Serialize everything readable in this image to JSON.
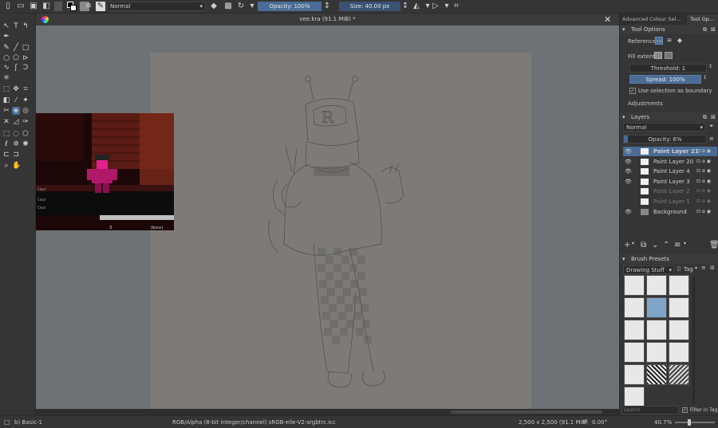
{
  "toolbar": {
    "blend_mode": "Normal",
    "opacity_label": "Opacity: 100%",
    "size_label": "Size: 40.00 px"
  },
  "document": {
    "title": "vee.kra (91.1 MiB) *"
  },
  "dock_tabs": {
    "advanced_colour": "Advanced Colour Sel...",
    "tool_options": "Tool Op..."
  },
  "tool_options": {
    "header": "Tool Options",
    "reference_label": "Reference",
    "fill_extent_label": "Fill extent",
    "threshold_label": "Threshold: 1",
    "spread_label": "Spread: 100%",
    "use_selection_label": "Use selection as boundary",
    "adjustments_label": "Adjustments"
  },
  "layers": {
    "header": "Layers",
    "blend_mode": "Normal",
    "opacity_label": "Opacity:  6%",
    "items": [
      {
        "name": "Paint Layer 21",
        "visible": true,
        "selected": true
      },
      {
        "name": "Paint Layer 20",
        "visible": true,
        "selected": false
      },
      {
        "name": "Paint Layer 4",
        "visible": true,
        "selected": false
      },
      {
        "name": "Paint Layer 3",
        "visible": true,
        "selected": false
      },
      {
        "name": "Paint Layer 2",
        "visible": false,
        "selected": false
      },
      {
        "name": "Paint Layer 1",
        "visible": false,
        "selected": false
      },
      {
        "name": "Background",
        "visible": true,
        "selected": false
      }
    ]
  },
  "brush_presets": {
    "header": "Brush Presets",
    "set_name": "Drawing Stuff",
    "tag_label": "Tag",
    "search_placeholder": "Search",
    "filter_label": "Filter in Tag"
  },
  "status": {
    "brush": "b) Basic-1",
    "color_model": "RGB/Alpha (8-bit integer/channel)  sRGB-elle-V2-srgbtrc.icc",
    "image_size": "2,500 x 2,500 (91.1 MiB)",
    "rotation": "0.00°",
    "zoom": "40.7%"
  },
  "photo": {
    "score_text": "3",
    "label_text": "[Name]"
  },
  "colors": {
    "accent": "#4a6c96",
    "canvas_bg": "#6e7274",
    "paper": "#7d7b79",
    "magenta": "#e0208c"
  }
}
